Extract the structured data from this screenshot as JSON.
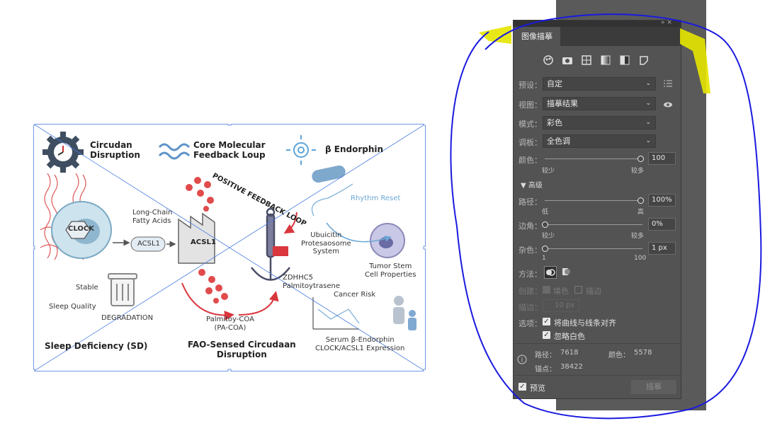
{
  "artwork": {
    "title_circadian": "Circudan\nDisruption",
    "title_core_loop": "Core Molecular\nFeedback Loup",
    "title_endorphin": "β Endorphin",
    "positive_loop": "POSITIVE FEEDBACK LOOP",
    "rhythm_reset": "Rhythm Reset",
    "clock": "CLOCK",
    "long_chain": "Long-Chain\nFatty Acids",
    "acsl1_label": "ACSL1",
    "acsl1_factory": "ACSL1",
    "ubiquitin": "Ubuicitin\nProtesaosome\nSystem",
    "tumor_stem": "Tumor Stem\nCell Properties",
    "stable": "Stable",
    "sleep_quality": "Sleep Quality",
    "degradation": "DEGRADATION",
    "zdhhc5": "ZDHHC5\nPalmitoytrasene",
    "cancer_risk": "Cancer Risk",
    "palmitoy": "Palmitoy-COA\n(PA-COA)",
    "sleep_deficiency": "Sleep Deficiency (SD)",
    "fao_sensed": "FAO-Sensed Circudaan\nDisruption",
    "serum": "Serum β-Endorphin\nCLOCK/ACSL1 Expression"
  },
  "panel": {
    "title": "图像描摹",
    "top_controls": "»  ×",
    "mode_icons": [
      "auto-color-icon",
      "camera-icon",
      "grid-photo-icon",
      "gradient-gray-icon",
      "half-fill-icon",
      "outline-shape-icon"
    ],
    "preset": {
      "label": "预设：",
      "value": "自定"
    },
    "view": {
      "label": "视图：",
      "value": "描摹结果"
    },
    "mode": {
      "label": "模式：",
      "value": "彩色"
    },
    "palette": {
      "label": "调板：",
      "value": "全色调"
    },
    "colors": {
      "label": "颜色：",
      "value": 100,
      "value_text": "100",
      "min_label": "较少",
      "max_label": "较多"
    },
    "advanced_label": "高级",
    "paths": {
      "label": "路径：",
      "value": 100,
      "value_text": "100%",
      "min_label": "低",
      "max_label": "高"
    },
    "corners": {
      "label": "边角：",
      "value": 0,
      "value_text": "0%",
      "min_label": "较少",
      "max_label": "较多"
    },
    "noise": {
      "label": "杂色：",
      "value": 1,
      "value_text": "1 px",
      "min_label": "1",
      "max_label": "100"
    },
    "method_label": "方法：",
    "create": {
      "label": "创建：",
      "fill": "填色",
      "stroke": "描边"
    },
    "stroke_width": {
      "label": "描边：",
      "value": "10 px"
    },
    "options": {
      "label": "选项：",
      "snap_curves": "将曲线与线条对齐",
      "ignore_white": "忽略白色"
    },
    "stats": {
      "paths_label": "路径：",
      "paths_value": "7618",
      "colors_label": "颜色：",
      "colors_value": "5578",
      "anchors_label": "锚点：",
      "anchors_value": "38422"
    },
    "preview_label": "预览",
    "trace_button": "描摹"
  },
  "colors": {
    "panel_bg": "#535353",
    "annotation_blue": "#1a1adf",
    "annotation_yellow": "#e6e600",
    "arrow_red": "#d9363e"
  }
}
